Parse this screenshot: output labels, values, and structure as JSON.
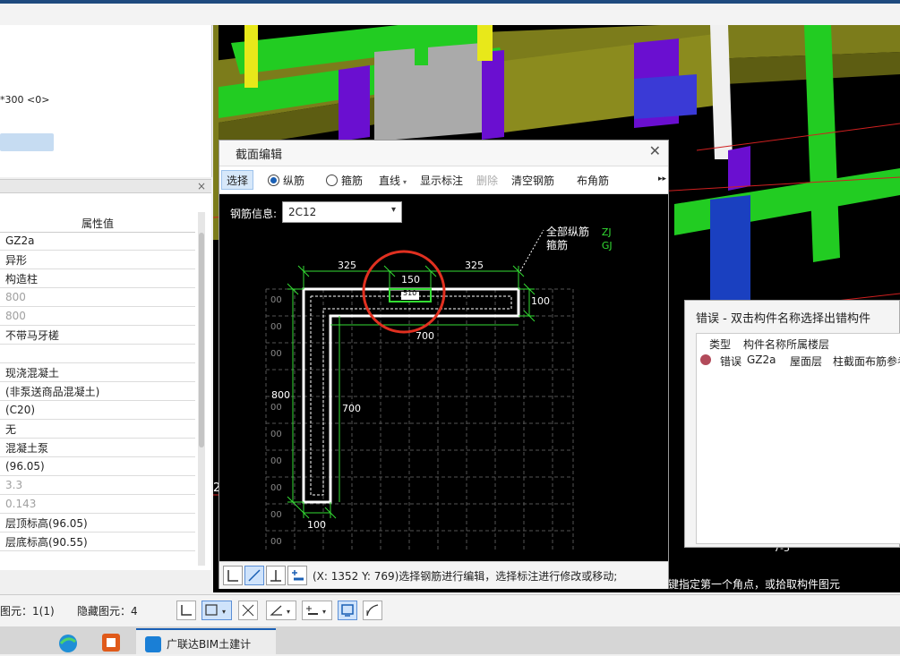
{
  "left_panel": {
    "fragment_line": "*300 <0>"
  },
  "properties": {
    "column_header": "属性值",
    "values": [
      {
        "text": "GZ2a",
        "muted": false
      },
      {
        "text": "异形",
        "muted": false
      },
      {
        "text": "构造柱",
        "muted": false
      },
      {
        "text": "800",
        "muted": true
      },
      {
        "text": "800",
        "muted": true
      },
      {
        "text": "不带马牙槎",
        "muted": false
      },
      {
        "text": "",
        "muted": false
      },
      {
        "text": "现浇混凝土",
        "muted": false
      },
      {
        "text": "(非泵送商品混凝土)",
        "muted": false
      },
      {
        "text": "(C20)",
        "muted": false
      },
      {
        "text": "无",
        "muted": false
      },
      {
        "text": "混凝土泵",
        "muted": false
      },
      {
        "text": "(96.05)",
        "muted": false
      },
      {
        "text": "3.3",
        "muted": true
      },
      {
        "text": "0.143",
        "muted": true
      },
      {
        "text": "层顶标高(96.05)",
        "muted": false
      },
      {
        "text": "层底标高(90.55)",
        "muted": false
      }
    ]
  },
  "viewport": {
    "hint": "键指定第一个角点，或拾取构件图元",
    "axis_mark": "7-5",
    "left_fragment": "2"
  },
  "dialog": {
    "title": "截面编辑",
    "toolbar": {
      "select": "选择",
      "longitudinal": "纵筋",
      "stirrup": "箍筋",
      "line": "直线",
      "show_dims": "显示标注",
      "delete": "删除",
      "clear": "清空钢筋",
      "corner": "布角筋",
      "more": "▸▸"
    },
    "rebar_info_label": "钢筋信息:",
    "rebar_info_value": "2C12",
    "legend": {
      "all_long_label": "全部纵筋",
      "all_long_code": "ZJ",
      "stirrup_label": "箍筋",
      "stirrup_code": "GJ"
    },
    "dims": {
      "top_left": "325",
      "top_mid": "150",
      "top_right": "325",
      "right_flange": "100",
      "flange_bottom": "700",
      "left_height": "800",
      "web_height": "700",
      "bottom_width": "100",
      "small_label": "510"
    },
    "grid_labels": [
      "00",
      "00",
      "00",
      "00",
      "00",
      "00",
      "00",
      "00",
      "00",
      "00"
    ],
    "status": "(X: 1352 Y: 769)选择钢筋进行编辑，选择标注进行修改或移动;"
  },
  "status_bar": {
    "selected": "图元：1(1)",
    "hidden": "隐藏图元：4"
  },
  "error_window": {
    "title": "错误 - 双击构件名称选择出错构件",
    "headers": [
      "类型",
      "构件名称",
      "所属楼层"
    ],
    "row": [
      "错误",
      "GZ2a",
      "屋面层",
      "柱截面布筋参考"
    ]
  },
  "taskbar": {
    "app_label": "广联达BIM土建计"
  },
  "colors": {
    "dim_green": "#33dd33",
    "highlight_red": "#e03020",
    "wireframe_green": "#22cc22",
    "wireframe_purple": "#6a0fd0",
    "wireframe_olive": "#8b8b1e",
    "wireframe_yellow": "#e8e81a"
  }
}
